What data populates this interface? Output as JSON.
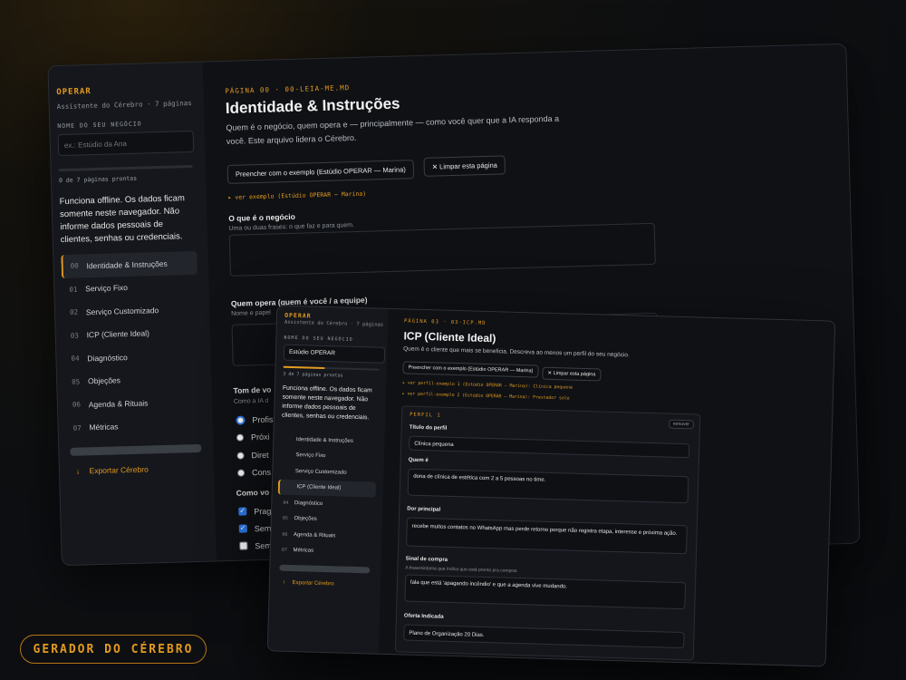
{
  "back": {
    "brand": "OPERAR",
    "brand_sub": "Assistente do Cérebro · 7 páginas",
    "business_label": "NOME DO SEU NEGÓCIO",
    "business_placeholder": "ex.: Estúdio da Ana",
    "progress_text": "0 de 7 páginas prontas",
    "progress": 0,
    "offline_note": "Funciona offline. Os dados ficam somente neste navegador. Não informe dados pessoais de clientes, senhas ou credenciais.",
    "nav": [
      {
        "num": "00",
        "label": "Identidade & Instruções",
        "active": true
      },
      {
        "num": "01",
        "label": "Serviço Fixo"
      },
      {
        "num": "02",
        "label": "Serviço Customizado"
      },
      {
        "num": "03",
        "label": "ICP (Cliente Ideal)"
      },
      {
        "num": "04",
        "label": "Diagnóstico"
      },
      {
        "num": "05",
        "label": "Objeções"
      },
      {
        "num": "06",
        "label": "Agenda & Rituais"
      },
      {
        "num": "07",
        "label": "Métricas"
      }
    ],
    "export_icon": "↓",
    "export_label": "Exportar Cérebro",
    "eyebrow": "PÁGINA 00 · 00-LEIA-ME.MD",
    "title": "Identidade & Instruções",
    "desc": "Quem é o negócio, quem opera e — principalmente — como você quer que a IA responda a você. Este arquivo lidera o Cérebro.",
    "btn_example": "Preencher com o exemplo (Estúdio OPERAR — Marina)",
    "btn_clear": "✕ Limpar esta página",
    "see_example": "▸ ver exemplo (Estúdio OPERAR — Marina)",
    "f1_title": "O que é o negócio",
    "f1_help": "Uma ou duas frases: o que faz e para quem.",
    "f2_title": "Quem opera (quem é você / a equipe)",
    "f2_help": "Nome e papel",
    "f3_title": "Tom de vo",
    "f3_help": "Como a IA d",
    "radios": [
      "Profis",
      "Próxi",
      "Diret",
      "Cons"
    ],
    "f4_title": "Como vo",
    "checks": [
      {
        "label": "Prag",
        "on": true
      },
      {
        "label": "Sem",
        "on": true
      },
      {
        "label": "Sem",
        "on": false
      }
    ]
  },
  "front": {
    "brand": "OPERAR",
    "brand_sub": "Assistente do Cérebro · 7 páginas",
    "business_label": "NOME DO SEU NEGÓCIO",
    "business_value": "Estúdio OPERAR",
    "progress_text": "3 de 7 páginas prontas",
    "progress": 0.43,
    "offline_note": "Funciona offline. Os dados ficam somente neste navegador. Não informe dados pessoais de clientes, senhas ou credenciais.",
    "nav": [
      {
        "num": "",
        "label": "Identidade & Instruções"
      },
      {
        "num": "",
        "label": "Serviço Fixo"
      },
      {
        "num": "",
        "label": "Serviço Customizado"
      },
      {
        "num": "",
        "label": "ICP (Cliente Ideal)",
        "active": true
      },
      {
        "num": "04",
        "label": "Diagnóstico"
      },
      {
        "num": "05",
        "label": "Objeções"
      },
      {
        "num": "06",
        "label": "Agenda & Rituais"
      },
      {
        "num": "07",
        "label": "Métricas"
      }
    ],
    "export_icon": "↑",
    "export_label": "Exportar Cérebro",
    "eyebrow": "PÁGINA 03 · 03-ICP.MD",
    "title": "ICP (Cliente Ideal)",
    "desc": "Quem é o cliente que mais se beneficia. Descreva ao menos um perfil do seu negócio.",
    "btn_example": "Preencher com o exemplo (Estúdio OPERAR — Marina)",
    "btn_clear": "✕ Limpar esta página",
    "see_example_1": "▸ ver perfil-exemplo 1 (Estúdio OPERAR — Marina): Clínica pequena",
    "see_example_2": "▸ ver perfil-exemplo 2 (Estúdio OPERAR — Marina): Prestador solo",
    "card_title": "PERFIL 1",
    "remove": "remover",
    "f_titulo": "Título do perfil",
    "v_titulo": "Clínica pequena",
    "f_quem": "Quem é",
    "v_quem": "dona de clínica de estética com 2 a 5 pessoas no time.",
    "f_dor": "Dor principal",
    "v_dor": "recebe muitos contatos no WhatsApp mas perde retorno porque não registra etapa, interesse e próxima ação.",
    "f_sinal": "Sinal de compra",
    "h_sinal": "A frase/sintoma que indica que está pronto pra comprar.",
    "v_sinal": "fala que está 'apagando incêndio' e que a agenda vive mudando.",
    "f_oferta": "Oferta Indicada",
    "v_oferta": "Plano de Organização 20 Dias."
  },
  "badge": "GERADOR DO CÉREBRO"
}
